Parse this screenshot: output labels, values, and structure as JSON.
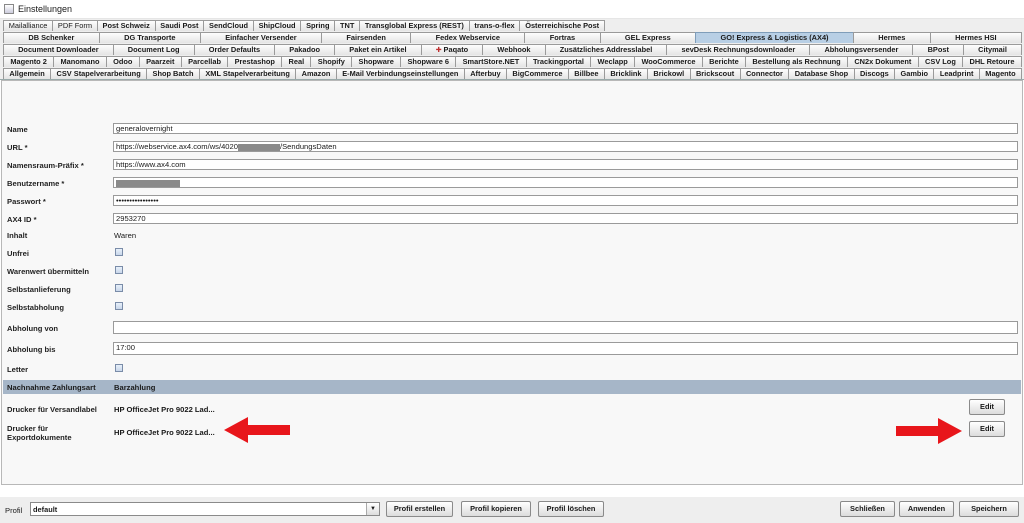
{
  "window": {
    "title": "Einstellungen"
  },
  "tabs": {
    "row1": [
      "Mailalliance",
      "PDF Form",
      "Post Schweiz",
      "Saudi Post",
      "SendCloud",
      "ShipCloud",
      "Spring",
      "TNT",
      "Transglobal Express (REST)",
      "trans-o-flex",
      "Österreichische Post"
    ],
    "row2": [
      "DB Schenker",
      "DG Transporte",
      "Einfacher Versender",
      "Fairsenden",
      "Fedex Webservice",
      "Fortras",
      "GEL Express",
      "GO! Express & Logistics (AX4)",
      "Hermes",
      "Hermes HSI"
    ],
    "row3": [
      "Document Downloader",
      "Document Log",
      "Order Defaults",
      "Pakadoo",
      "Paket ein Artikel",
      "Paqato",
      "Webhook",
      "Zusätzliches Addresslabel",
      "sevDesk Rechnungsdownloader",
      "Abholungsversender",
      "BPost",
      "Citymail"
    ],
    "row4": [
      "Magento 2",
      "Manomano",
      "Odoo",
      "Paarzeit",
      "Parcellab",
      "Prestashop",
      "Real",
      "Shopify",
      "Shopware",
      "Shopware 6",
      "SmartStore.NET",
      "Trackingportal",
      "Weclapp",
      "WooCommerce",
      "Berichte",
      "Bestellung als Rechnung",
      "CN2x Dokument",
      "CSV Log",
      "DHL Retoure"
    ],
    "row5": [
      "Allgemein",
      "CSV Stapelverarbeitung",
      "Shop Batch",
      "XML Stapelverarbeitung",
      "Amazon",
      "E-Mail Verbindungseinstellungen",
      "Afterbuy",
      "BigCommerce",
      "Billbee",
      "Bricklink",
      "Brickowl",
      "Brickscout",
      "Connector",
      "Database Shop",
      "Discogs",
      "Gambio",
      "Leadprint",
      "Magento"
    ]
  },
  "form": {
    "name_label": "Name",
    "name_value": "generalovernight",
    "url_label": "URL *",
    "url_prefix": "https://webservice.ax4.com/ws/4020",
    "url_suffix": "/SendungsDaten",
    "ns_label": "Namensraum-Präfix *",
    "ns_value": "https://www.ax4.com",
    "user_label": "Benutzername *",
    "pass_label": "Passwort *",
    "pass_value": "••••••••••••••••",
    "ax4_label": "AX4 ID *",
    "ax4_value": "2953270",
    "inhalt_label": "Inhalt",
    "inhalt_value": "Waren",
    "unfrei_label": "Unfrei",
    "warenwert_label": "Warenwert übermitteln",
    "selbstanl_label": "Selbstanlieferung",
    "selbstabh_label": "Selbstabholung",
    "abholung_von_label": "Abholung von",
    "abholung_von_value": "",
    "abholung_bis_label": "Abholung bis",
    "abholung_bis_value": "17:00",
    "letter_label": "Letter",
    "nachnahme_label": "Nachnahme Zahlungsart",
    "nachnahme_value": "Barzahlung",
    "drucker_versand_label": "Drucker für Versandlabel",
    "drucker_versand_value": "HP OfficeJet Pro 9022 Lad...",
    "drucker_export_label_1": "Drucker für",
    "drucker_export_label_2": "Exportdokumente",
    "drucker_export_value": "HP OfficeJet Pro 9022 Lad...",
    "edit_label": "Edit"
  },
  "footer": {
    "profil_label": "Profil",
    "profil_value": "default",
    "profil_erstellen": "Profil erstellen",
    "profil_kopieren": "Profil kopieren",
    "profil_loeschen": "Profil löschen",
    "schliessen": "Schließen",
    "anwenden": "Anwenden",
    "speichern": "Speichern"
  },
  "colors": {
    "active_tab": "#b8cfe5",
    "annotation_arrow": "#e8161b",
    "selected_row": "#a6b6c8"
  }
}
